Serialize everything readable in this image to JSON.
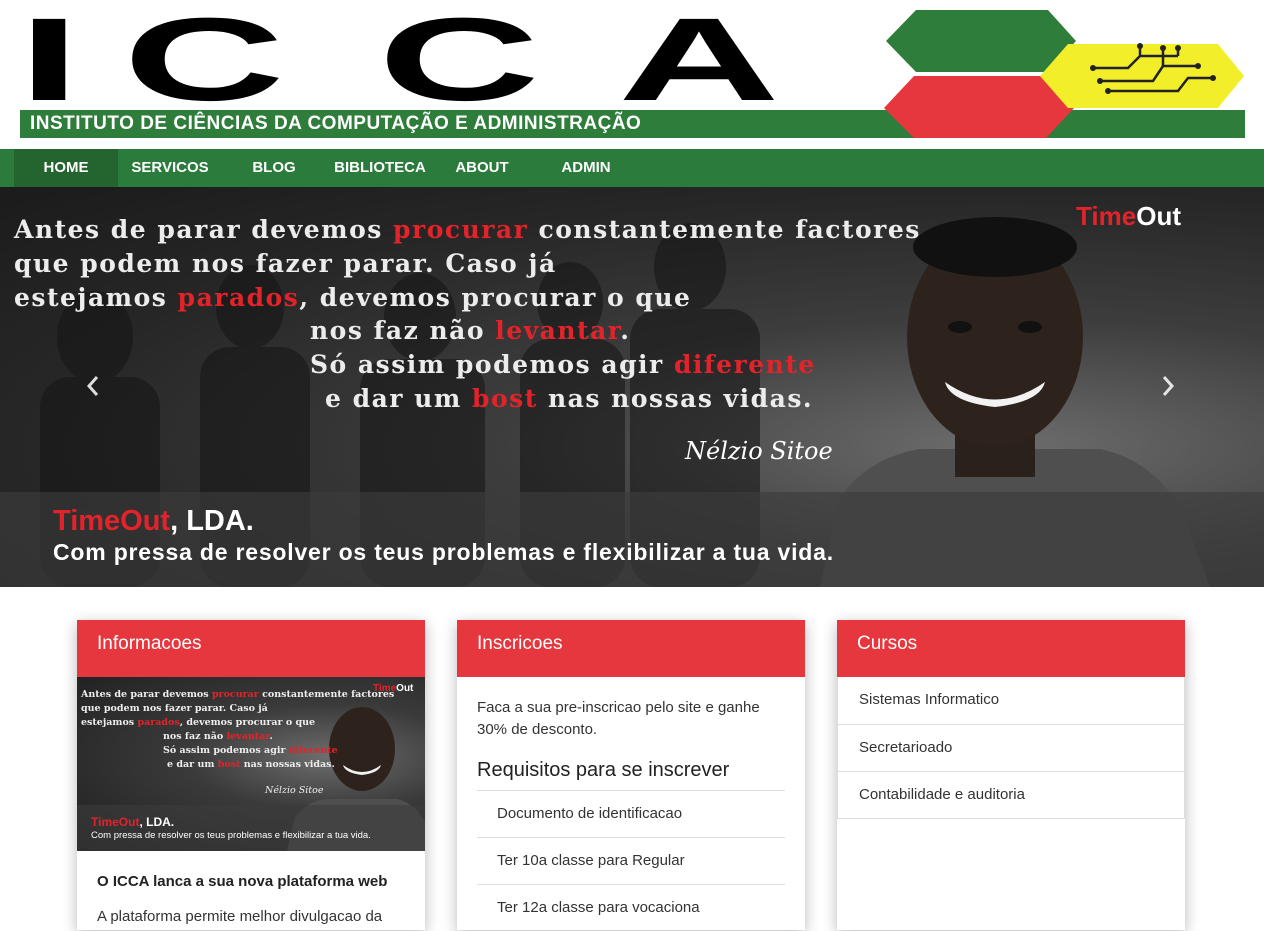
{
  "header": {
    "logo_letters": [
      "I",
      "C",
      "C",
      "A"
    ],
    "logo_tagline": "INSTITUTO DE CIÊNCIAS DA COMPUTAÇÃO E ADMINISTRAÇÃO"
  },
  "nav": {
    "items": [
      {
        "label": "HOME",
        "active": true
      },
      {
        "label": "SERVICOS",
        "active": false
      },
      {
        "label": "BLOG",
        "active": false
      },
      {
        "label": "BIBLIOTECA",
        "active": false
      },
      {
        "label": "ABOUT",
        "active": false
      },
      {
        "label": "ADMIN",
        "active": false
      }
    ]
  },
  "carousel": {
    "brand_red": "Time",
    "brand_white": "Out",
    "quote": {
      "l1_a": "Antes de parar devemos ",
      "l1_hl": "procurar",
      "l1_b": " constantemente factores",
      "l2": "que podem nos fazer parar. Caso já",
      "l3_a": "estejamos ",
      "l3_hl": "parados",
      "l3_b": ", devemos procurar o que",
      "l4_a": "nos faz não ",
      "l4_hl": "levantar",
      "l4_b": ".",
      "l5_a": "Só assim podemos agir ",
      "l5_hl": "diferente",
      "l6_a": "e dar um ",
      "l6_hl": "bost",
      "l6_b": " nas nossas vidas."
    },
    "signature": "Nélzio Sitoe",
    "caption_title_red": "TimeOut",
    "caption_title_rest": ", LDA.",
    "caption_subtitle": "Com pressa de resolver os teus problemas e flexibilizar a tua vida.",
    "prev_icon": "chevron-left-icon",
    "next_icon": "chevron-right-icon"
  },
  "cards": {
    "info": {
      "header": "Informacoes",
      "title": "O ICCA lanca a sua nova plataforma web",
      "text": "A plataforma permite melhor divulgacao da"
    },
    "inscricoes": {
      "header": "Inscricoes",
      "text": "Faca a sua pre-inscricao pelo site e ganhe 30% de desconto.",
      "requirements_title": "Requisitos para se inscrever",
      "requirements": [
        "Documento de identificacao",
        "Ter 10a classe para Regular",
        "Ter 12a classe para vocaciona"
      ]
    },
    "cursos": {
      "header": "Cursos",
      "items": [
        "Sistemas Informatico",
        "Secretarioado",
        "Contabilidade e auditoria"
      ]
    }
  },
  "colors": {
    "nav_green": "#2b7b3c",
    "card_red": "#e7373e",
    "accent_red": "#e2232a",
    "logo_yellow": "#f2ee29"
  }
}
